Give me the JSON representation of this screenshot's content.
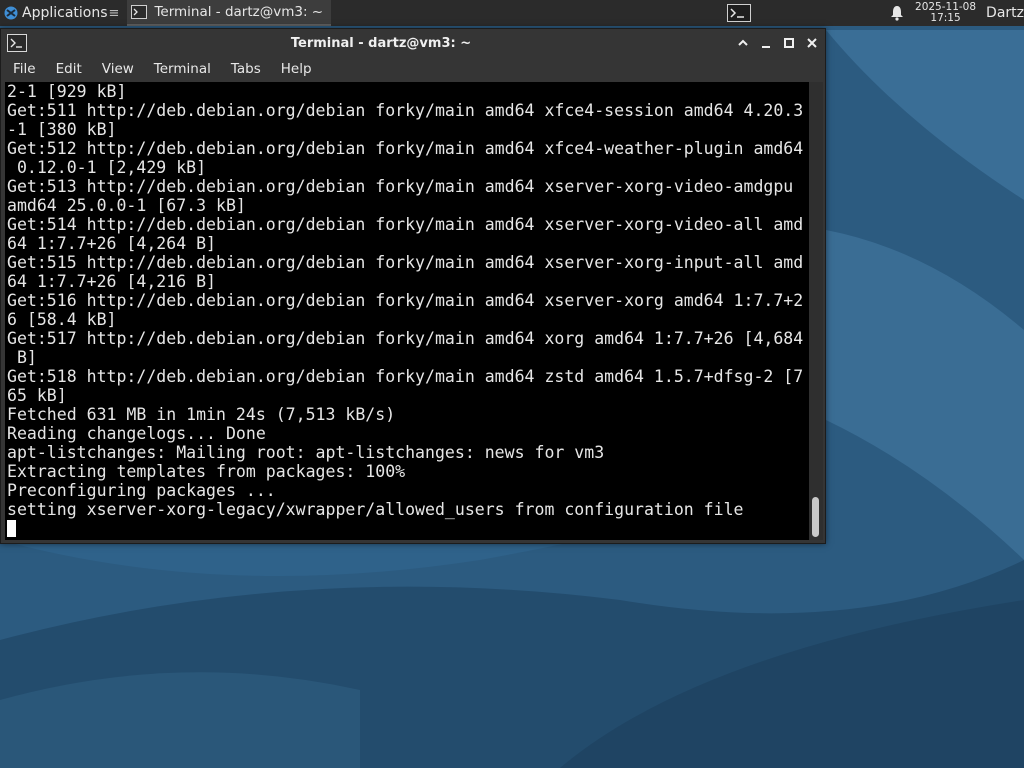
{
  "panel": {
    "applications_label": "Applications",
    "applications_separator": "≡",
    "task_terminal_label": "Terminal - dartz@vm3: ~",
    "clock_date": "2025-11-08",
    "clock_time": "17:15",
    "user_name": "Dartz"
  },
  "window": {
    "title": "Terminal - dartz@vm3: ~",
    "menu": [
      "File",
      "Edit",
      "View",
      "Terminal",
      "Tabs",
      "Help"
    ]
  },
  "terminal": {
    "lines": [
      "2-1 [929 kB]",
      "Get:511 http://deb.debian.org/debian forky/main amd64 xfce4-session amd64 4.20.3",
      "-1 [380 kB]",
      "Get:512 http://deb.debian.org/debian forky/main amd64 xfce4-weather-plugin amd64",
      " 0.12.0-1 [2,429 kB]",
      "Get:513 http://deb.debian.org/debian forky/main amd64 xserver-xorg-video-amdgpu",
      "amd64 25.0.0-1 [67.3 kB]",
      "Get:514 http://deb.debian.org/debian forky/main amd64 xserver-xorg-video-all amd",
      "64 1:7.7+26 [4,264 B]",
      "Get:515 http://deb.debian.org/debian forky/main amd64 xserver-xorg-input-all amd",
      "64 1:7.7+26 [4,216 B]",
      "Get:516 http://deb.debian.org/debian forky/main amd64 xserver-xorg amd64 1:7.7+2",
      "6 [58.4 kB]",
      "Get:517 http://deb.debian.org/debian forky/main amd64 xorg amd64 1:7.7+26 [4,684",
      " B]",
      "Get:518 http://deb.debian.org/debian forky/main amd64 zstd amd64 1.5.7+dfsg-2 [7",
      "65 kB]",
      "Fetched 631 MB in 1min 24s (7,513 kB/s)",
      "Reading changelogs... Done",
      "apt-listchanges: Mailing root: apt-listchanges: news for vm3",
      "Extracting templates from packages: 100%",
      "Preconfiguring packages ...",
      "setting xserver-xorg-legacy/xwrapper/allowed_users from configuration file"
    ]
  },
  "icons": {
    "apps": "xfce-logo-icon",
    "task": "terminal-icon",
    "launcher": "terminal-launcher-icon",
    "notifications": "bell-icon",
    "window_controls": [
      "maximize-up-icon",
      "minimize-icon",
      "restore-icon",
      "close-icon"
    ]
  },
  "colors": {
    "panel_bg": "#2b2b2b",
    "window_bg": "#353535",
    "terminal_bg": "#000000",
    "terminal_fg": "#e6e6e6",
    "desktop_bg": "#2c5d84"
  }
}
